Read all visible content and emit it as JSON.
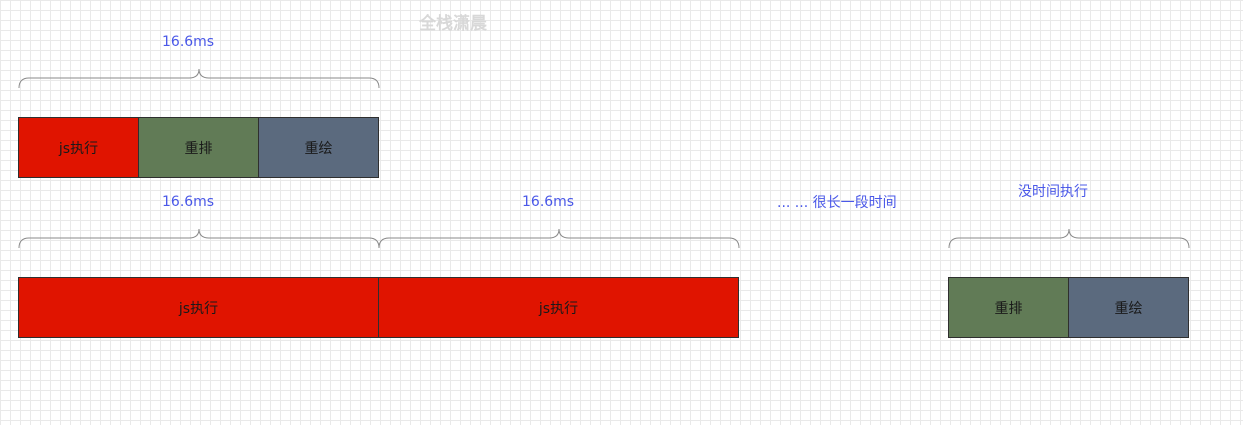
{
  "watermark": "全栈潇晨",
  "rows": {
    "top": {
      "brace_label": "16.6ms",
      "blocks": [
        "js执行",
        "重排",
        "重绘"
      ]
    },
    "bottom": {
      "frame1_label": "16.6ms",
      "frame2_label": "16.6ms",
      "gap_label": "... ... 很长一段时间",
      "late_label": "没时间执行",
      "js_blocks": [
        "js执行",
        "js执行"
      ],
      "late_blocks": [
        "重排",
        "重绘"
      ]
    }
  },
  "colors": {
    "js": "#e01400",
    "reflow": "#617b56",
    "repaint": "#5b6a7e",
    "label": "#4a58e8",
    "brace": "#8a8a8a"
  }
}
